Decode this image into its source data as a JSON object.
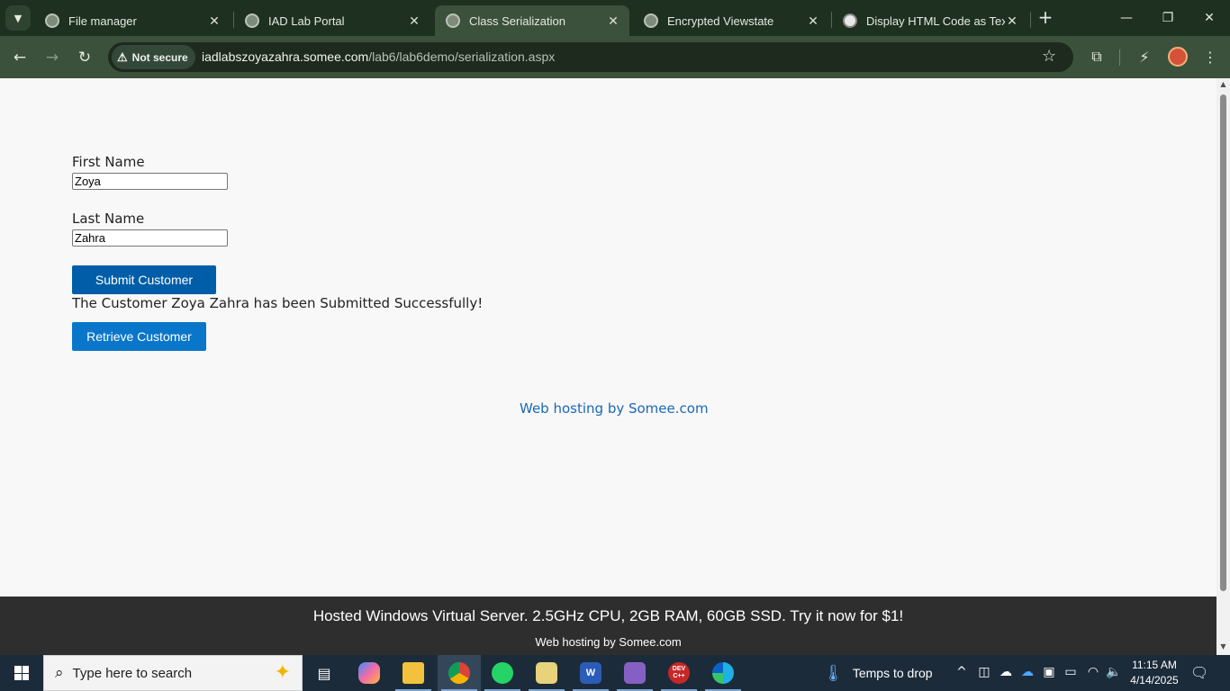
{
  "browser": {
    "tabs": [
      {
        "title": "File manager",
        "active": false,
        "favicon": "globe-icon"
      },
      {
        "title": "IAD Lab Portal",
        "active": false,
        "favicon": "globe-icon"
      },
      {
        "title": "Class Serialization",
        "active": true,
        "favicon": "globe-icon"
      },
      {
        "title": "Encrypted Viewstate",
        "active": false,
        "favicon": "globe-icon"
      },
      {
        "title": "Display HTML Code as Text",
        "active": false,
        "favicon": "openai-icon"
      }
    ],
    "security_label": "Not secure",
    "url_host": "iadlabszoyazahra.somee.com",
    "url_path": "/lab6/lab6demo/serialization.aspx",
    "accent_color": "#3c513b"
  },
  "page": {
    "first_name_label": "First Name",
    "first_name_value": "Zoya",
    "last_name_label": "Last Name",
    "last_name_value": "Zahra",
    "submit_button": "Submit Customer",
    "status_message": "The Customer Zoya Zahra has been Submitted Successfully!",
    "retrieve_button": "Retrieve Customer",
    "hosting_link": "Web hosting by Somee.com",
    "banner_text": "Hosted Windows Virtual Server. 2.5GHz CPU, 2GB RAM, 60GB SSD. Try it now for $1!",
    "banner_subtext": "Web hosting by Somee.com"
  },
  "taskbar": {
    "search_placeholder": "Type here to search",
    "weather_text": "Temps to drop",
    "time": "11:15 AM",
    "date": "4/14/2025",
    "apps": [
      {
        "name": "task-view-icon"
      },
      {
        "name": "copilot-icon"
      },
      {
        "name": "file-explorer-icon"
      },
      {
        "name": "chrome-icon"
      },
      {
        "name": "whatsapp-icon"
      },
      {
        "name": "paint-icon"
      },
      {
        "name": "word-icon",
        "label": "W"
      },
      {
        "name": "visual-studio-icon"
      },
      {
        "name": "devcpp-icon",
        "label": "DEV C++"
      },
      {
        "name": "edge-icon"
      }
    ]
  }
}
